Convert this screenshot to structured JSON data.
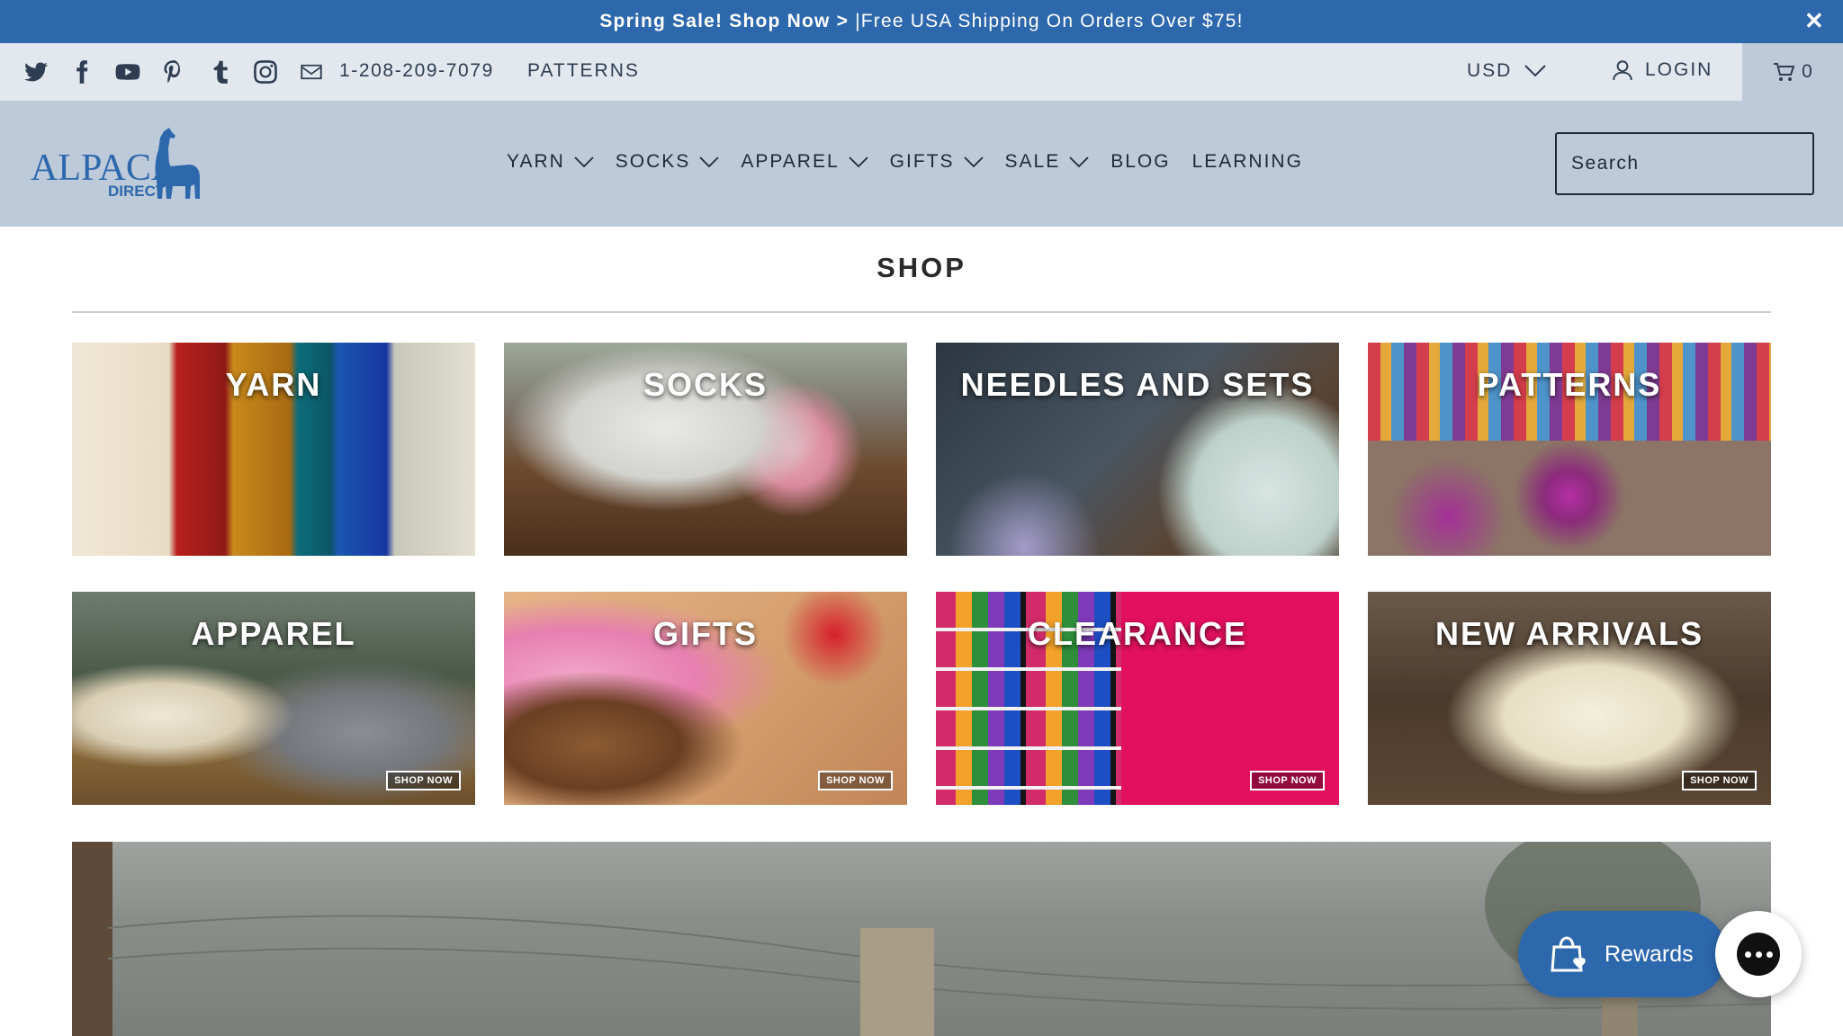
{
  "announcement": {
    "bold_text": "Spring Sale! Shop Now >",
    "text": "|Free USA Shipping On Orders Over $75!",
    "close": "✕"
  },
  "utility": {
    "socials": [
      "twitter-icon",
      "facebook-icon",
      "youtube-icon",
      "pinterest-icon",
      "tumblr-icon",
      "instagram-icon",
      "mail-icon"
    ],
    "phone": "1-208-209-7079",
    "patterns": "PATTERNS",
    "currency": "USD",
    "login": "LOGIN",
    "cart_count": "0"
  },
  "header": {
    "logo_text": "ALPACA",
    "logo_sub": "DIRECT",
    "nav": [
      {
        "label": "YARN",
        "dropdown": true
      },
      {
        "label": "SOCKS",
        "dropdown": true
      },
      {
        "label": "APPAREL",
        "dropdown": true
      },
      {
        "label": "GIFTS",
        "dropdown": true
      },
      {
        "label": "SALE",
        "dropdown": true
      },
      {
        "label": "BLOG",
        "dropdown": false
      },
      {
        "label": "LEARNING",
        "dropdown": false
      }
    ],
    "search_placeholder": "Search"
  },
  "shop": {
    "title": "SHOP",
    "tiles": [
      {
        "label": "YARN",
        "cta": ""
      },
      {
        "label": "SOCKS",
        "cta": ""
      },
      {
        "label": "NEEDLES AND SETS",
        "cta": ""
      },
      {
        "label": "PATTERNS",
        "cta": ""
      },
      {
        "label": "APPAREL",
        "cta": "SHOP NOW"
      },
      {
        "label": "GIFTS",
        "cta": "SHOP NOW"
      },
      {
        "label": "CLEARANCE",
        "cta": "SHOP NOW"
      },
      {
        "label": "NEW ARRIVALS",
        "cta": "SHOP NOW"
      }
    ]
  },
  "widgets": {
    "rewards_label": "Rewards"
  },
  "colors": {
    "brand_blue": "#2d68ad",
    "header_bg": "#bdcad9",
    "utility_bg": "#e3e8ee"
  }
}
